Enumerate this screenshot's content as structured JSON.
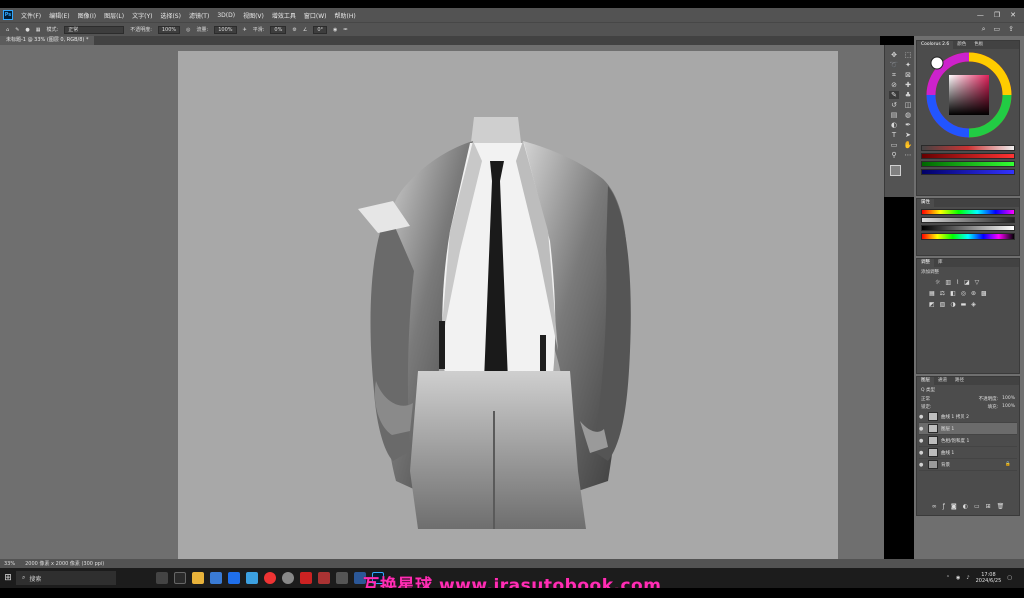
{
  "menubar": {
    "logo": "Ps",
    "items": [
      "文件(F)",
      "编辑(E)",
      "图像(I)",
      "图层(L)",
      "文字(Y)",
      "选择(S)",
      "滤镜(T)",
      "3D(D)",
      "视图(V)",
      "增效工具",
      "窗口(W)",
      "帮助(H)"
    ],
    "minimize": "—",
    "maximize": "❐",
    "close": "✕"
  },
  "options": {
    "mode_label": "模式:",
    "mode_value": "正常",
    "opacity_label": "不透明度:",
    "opacity_value": "100%",
    "flow_label": "流量:",
    "flow_value": "100%",
    "smooth_label": "平滑:",
    "smooth_value": "0%",
    "angle_value": "0°"
  },
  "document": {
    "tab_label": "未标题-1 @ 33% (图层 0, RGB/8) *"
  },
  "status": {
    "zoom": "33%",
    "doc_size": "2000 像素 x 2000 像素 (300 ppi)"
  },
  "color_panel": {
    "tabs": [
      "Coolorus 2.6",
      "颜色",
      "色板"
    ]
  },
  "sliders_panel": {
    "tabs": [
      "属性"
    ],
    "values": [
      "0",
      "0",
      "0"
    ]
  },
  "adjust_panel": {
    "tabs": [
      "调整",
      "库"
    ],
    "title": "添加调整"
  },
  "layers_panel": {
    "tabs": [
      "图层",
      "通道",
      "路径"
    ],
    "kind_label": "Q 类型",
    "blend_mode": "正常",
    "opacity_label": "不透明度:",
    "opacity_value": "100%",
    "lock_label": "锁定:",
    "fill_label": "填充:",
    "fill_value": "100%",
    "layers": [
      {
        "name": "曲线 1 拷贝 2",
        "selected": false
      },
      {
        "name": "图层 1",
        "selected": true
      },
      {
        "name": "色相/饱和度 1",
        "selected": false
      },
      {
        "name": "曲线 1",
        "selected": false
      },
      {
        "name": "背景",
        "selected": false
      }
    ]
  },
  "taskbar": {
    "search_placeholder": "搜索",
    "time": "17:08",
    "date": "2024/6/25"
  },
  "watermark": "互换星球 www.irasutobook.com",
  "colors": {
    "ui_bg": "#535353",
    "workspace": "#6f6f6f",
    "canvas": "#a8a8a8",
    "watermark": "#ff2db4"
  },
  "icons": [
    "move-icon",
    "marquee-icon",
    "lasso-icon",
    "magic-wand-icon",
    "crop-icon",
    "eyedropper-icon",
    "healing-icon",
    "brush-icon",
    "clone-stamp-icon",
    "history-brush-icon",
    "eraser-icon",
    "gradient-icon",
    "blur-icon",
    "dodge-icon",
    "pen-icon",
    "type-icon",
    "path-select-icon",
    "shape-icon",
    "hand-icon",
    "zoom-icon"
  ]
}
